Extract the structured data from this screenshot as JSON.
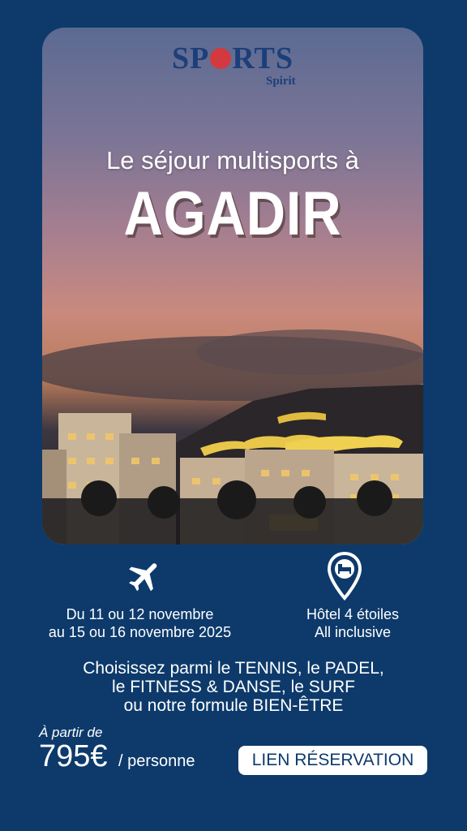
{
  "logo": {
    "word_before": "SP",
    "word_after": "RTS",
    "sub": "Spirit"
  },
  "hero": {
    "subtitle": "Le séjour multisports à",
    "title": "AGADIR"
  },
  "dates": {
    "icon": "airplane-icon",
    "line1": "Du 11 ou 12 novembre",
    "line2": "au 15 ou 16 novembre 2025"
  },
  "hotel": {
    "icon": "hotel-location-pin-icon",
    "line1": "Hôtel 4 étoiles",
    "line2": "All inclusive"
  },
  "sports": {
    "line1": "Choisissez parmi le TENNIS, le PADEL,",
    "line2": "le FITNESS & DANSE, le SURF",
    "line3": "ou notre formule BIEN-ÊTRE"
  },
  "price": {
    "label": "À partir de",
    "value": "795€",
    "unit": "/ personne"
  },
  "cta": {
    "label": "LIEN RÉSERVATION"
  },
  "colors": {
    "background": "#0d3a6b",
    "logo": "#1c3f7a",
    "accent": "#d23a3f"
  }
}
